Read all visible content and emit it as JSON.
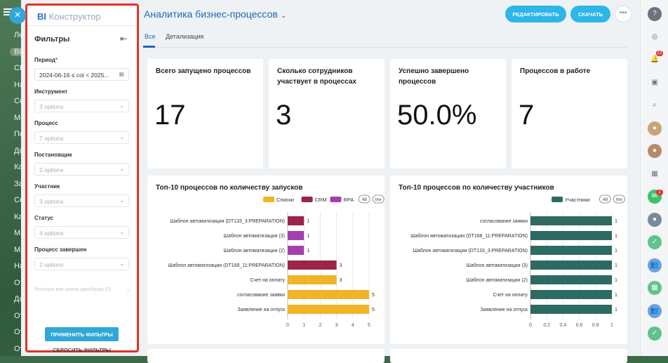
{
  "left_menu": {
    "items": [
      "Лен",
      "BI Ко",
      "CRM",
      "Нау",
      "Сотр",
      "Месс",
      "Почт",
      "Доск",
      "Кале",
      "Задач",
      "Серв",
      "Кана",
      "Мар",
      "Мар",
      "Наст",
      "Отче",
      "Доку",
      "Отче",
      "Отче",
      "Отче"
    ]
  },
  "filter_panel": {
    "logo_bold": "BI",
    "logo_rest": " Конструктор",
    "title": "Фильтры",
    "fields": [
      {
        "label": "Период",
        "required": true,
        "value": "2024-06-16 ≤ col < 2025...",
        "placeholder": ""
      },
      {
        "label": "Инструмент",
        "required": false,
        "value": "",
        "placeholder": "3 options"
      },
      {
        "label": "Процесс",
        "required": false,
        "value": "",
        "placeholder": "7 options"
      },
      {
        "label": "Постановщик",
        "required": false,
        "value": "",
        "placeholder": "2 options"
      },
      {
        "label": "Участник",
        "required": false,
        "value": "",
        "placeholder": "3 options"
      },
      {
        "label": "Статус",
        "required": false,
        "value": "",
        "placeholder": "4 options"
      },
      {
        "label": "Процесс завершен",
        "required": false,
        "value": "",
        "placeholder": "2 options"
      }
    ],
    "outside_filters": "Фильтры вне рамок дашборда (0)",
    "apply_label": "ПРИМЕНИТЬ ФИЛЬТРЫ",
    "reset_label": "СБРОСИТЬ ФИЛЬТРЫ"
  },
  "header": {
    "title": "Аналитика бизнес-процессов",
    "edit_label": "РЕДАКТИРОВАТЬ",
    "download_label": "СКАЧАТЬ",
    "more_label": "•••"
  },
  "tabs": [
    {
      "label": "Все",
      "active": true
    },
    {
      "label": "Детализация",
      "active": false
    }
  ],
  "kpis": [
    {
      "title": "Всего запущено процессов",
      "value": "17"
    },
    {
      "title": "Сколько сотрудников участвует в процессах",
      "value": "3"
    },
    {
      "title": "Успешно завершено процессов",
      "value": "50.0%"
    },
    {
      "title": "Процессов в работе",
      "value": "7"
    }
  ],
  "chart_data": [
    {
      "type": "bar",
      "orientation": "horizontal",
      "stacked": true,
      "title": "Топ-10 процессов по количеству запусков",
      "legend_controls": [
        "All",
        "Inv"
      ],
      "categories": [
        "Шаблон автоматизации (DT133_3:PREPARATION)",
        "Шаблон автоматизации (3)",
        "Шаблон автоматизации (2)",
        "Шаблон автоматизации (DT168_11:PREPARATION)",
        "Счет на оплату",
        "согласование заявки",
        "Заявление на отпуск"
      ],
      "series": [
        {
          "name": "Списки",
          "color": "#f0b429",
          "values": [
            0,
            0,
            0,
            0,
            3,
            5,
            5
          ]
        },
        {
          "name": "CRM",
          "color": "#9b2448",
          "values": [
            1,
            0,
            0,
            3,
            0,
            0,
            0
          ]
        },
        {
          "name": "RPA",
          "color": "#a63fae",
          "values": [
            0,
            1,
            1,
            0,
            0,
            0,
            0
          ]
        }
      ],
      "totals": [
        1,
        1,
        1,
        3,
        3,
        5,
        5
      ],
      "xlim": [
        0,
        5
      ],
      "xticks": [
        "0",
        "1",
        "2",
        "3",
        "4",
        "5"
      ]
    },
    {
      "type": "bar",
      "orientation": "horizontal",
      "title": "Топ-10 процессов по количеству участников",
      "legend_controls": [
        "All",
        "Inv"
      ],
      "categories": [
        "согласование заявки",
        "Шаблон автоматизации (DT168_11:PREPARATION)",
        "Шаблон автоматизации (DT133_3:PREPARATION)",
        "Шаблон автоматизации (3)",
        "Шаблон автоматизации (2)",
        "Счет на оплату",
        "Заявление на отпуск"
      ],
      "series": [
        {
          "name": "Участники",
          "color": "#2d6b62",
          "values": [
            1,
            1,
            1,
            1,
            1,
            1,
            1
          ]
        }
      ],
      "xlim": [
        0,
        1
      ],
      "xticks": [
        "0",
        "0.2",
        "0.4",
        "0.6",
        "0.8",
        "1"
      ]
    }
  ],
  "right_rail": {
    "icons": [
      "help-icon",
      "openai-icon",
      "bell-icon",
      "chat-icon",
      "search-icon",
      "avatar-1",
      "avatar-2",
      "widgets-icon",
      "mail-icon",
      "avatar-3",
      "tasks-icon",
      "contacts-icon",
      "calendar-icon",
      "group-icon",
      "check-icon"
    ],
    "notifications_badge": "22",
    "avatar_badge": "1"
  }
}
